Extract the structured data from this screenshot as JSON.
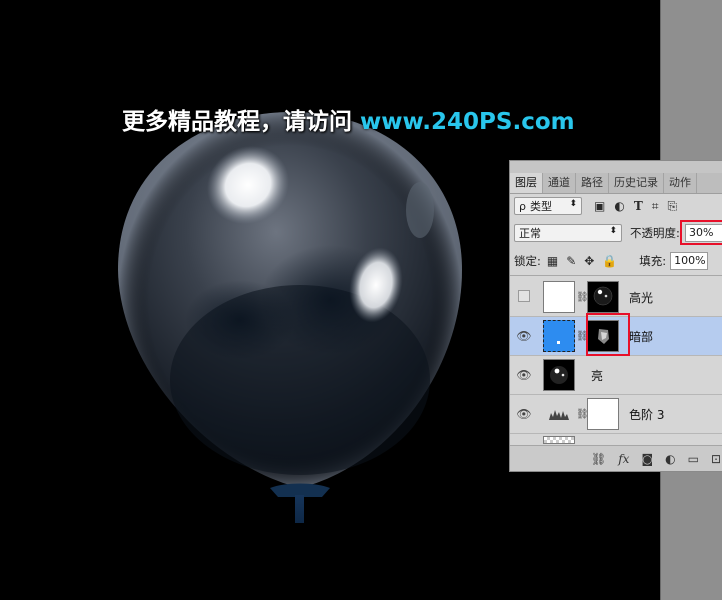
{
  "watermark": {
    "text_cn": "更多精品教程，请访问",
    "url": "www.240PS.com"
  },
  "colors": {
    "canvas_bg": "#000000",
    "panel_bg": "#d6d6d6",
    "selected_row": "#b6ccef",
    "highlight_box": "#e8102a",
    "layer_blue": "#2d8cf0",
    "watermark_url": "#29c6ec"
  },
  "panel": {
    "tabs": [
      {
        "label": "图层",
        "active": true
      },
      {
        "label": "通道",
        "active": false
      },
      {
        "label": "路径",
        "active": false
      },
      {
        "label": "历史记录",
        "active": false
      },
      {
        "label": "动作",
        "active": false
      }
    ],
    "filter": {
      "prefix": "ρ",
      "label": "类型"
    },
    "blend_mode": "正常",
    "opacity_label": "不透明度:",
    "opacity_value": "30%",
    "lock_label": "锁定:",
    "fill_label": "填充:",
    "fill_value": "100%",
    "layers": [
      {
        "name": "高光",
        "visible": false,
        "selected": false
      },
      {
        "name": "暗部",
        "visible": true,
        "selected": true
      },
      {
        "name": "亮",
        "visible": true,
        "selected": false
      },
      {
        "name": "色阶 3",
        "visible": true,
        "selected": false
      }
    ]
  }
}
